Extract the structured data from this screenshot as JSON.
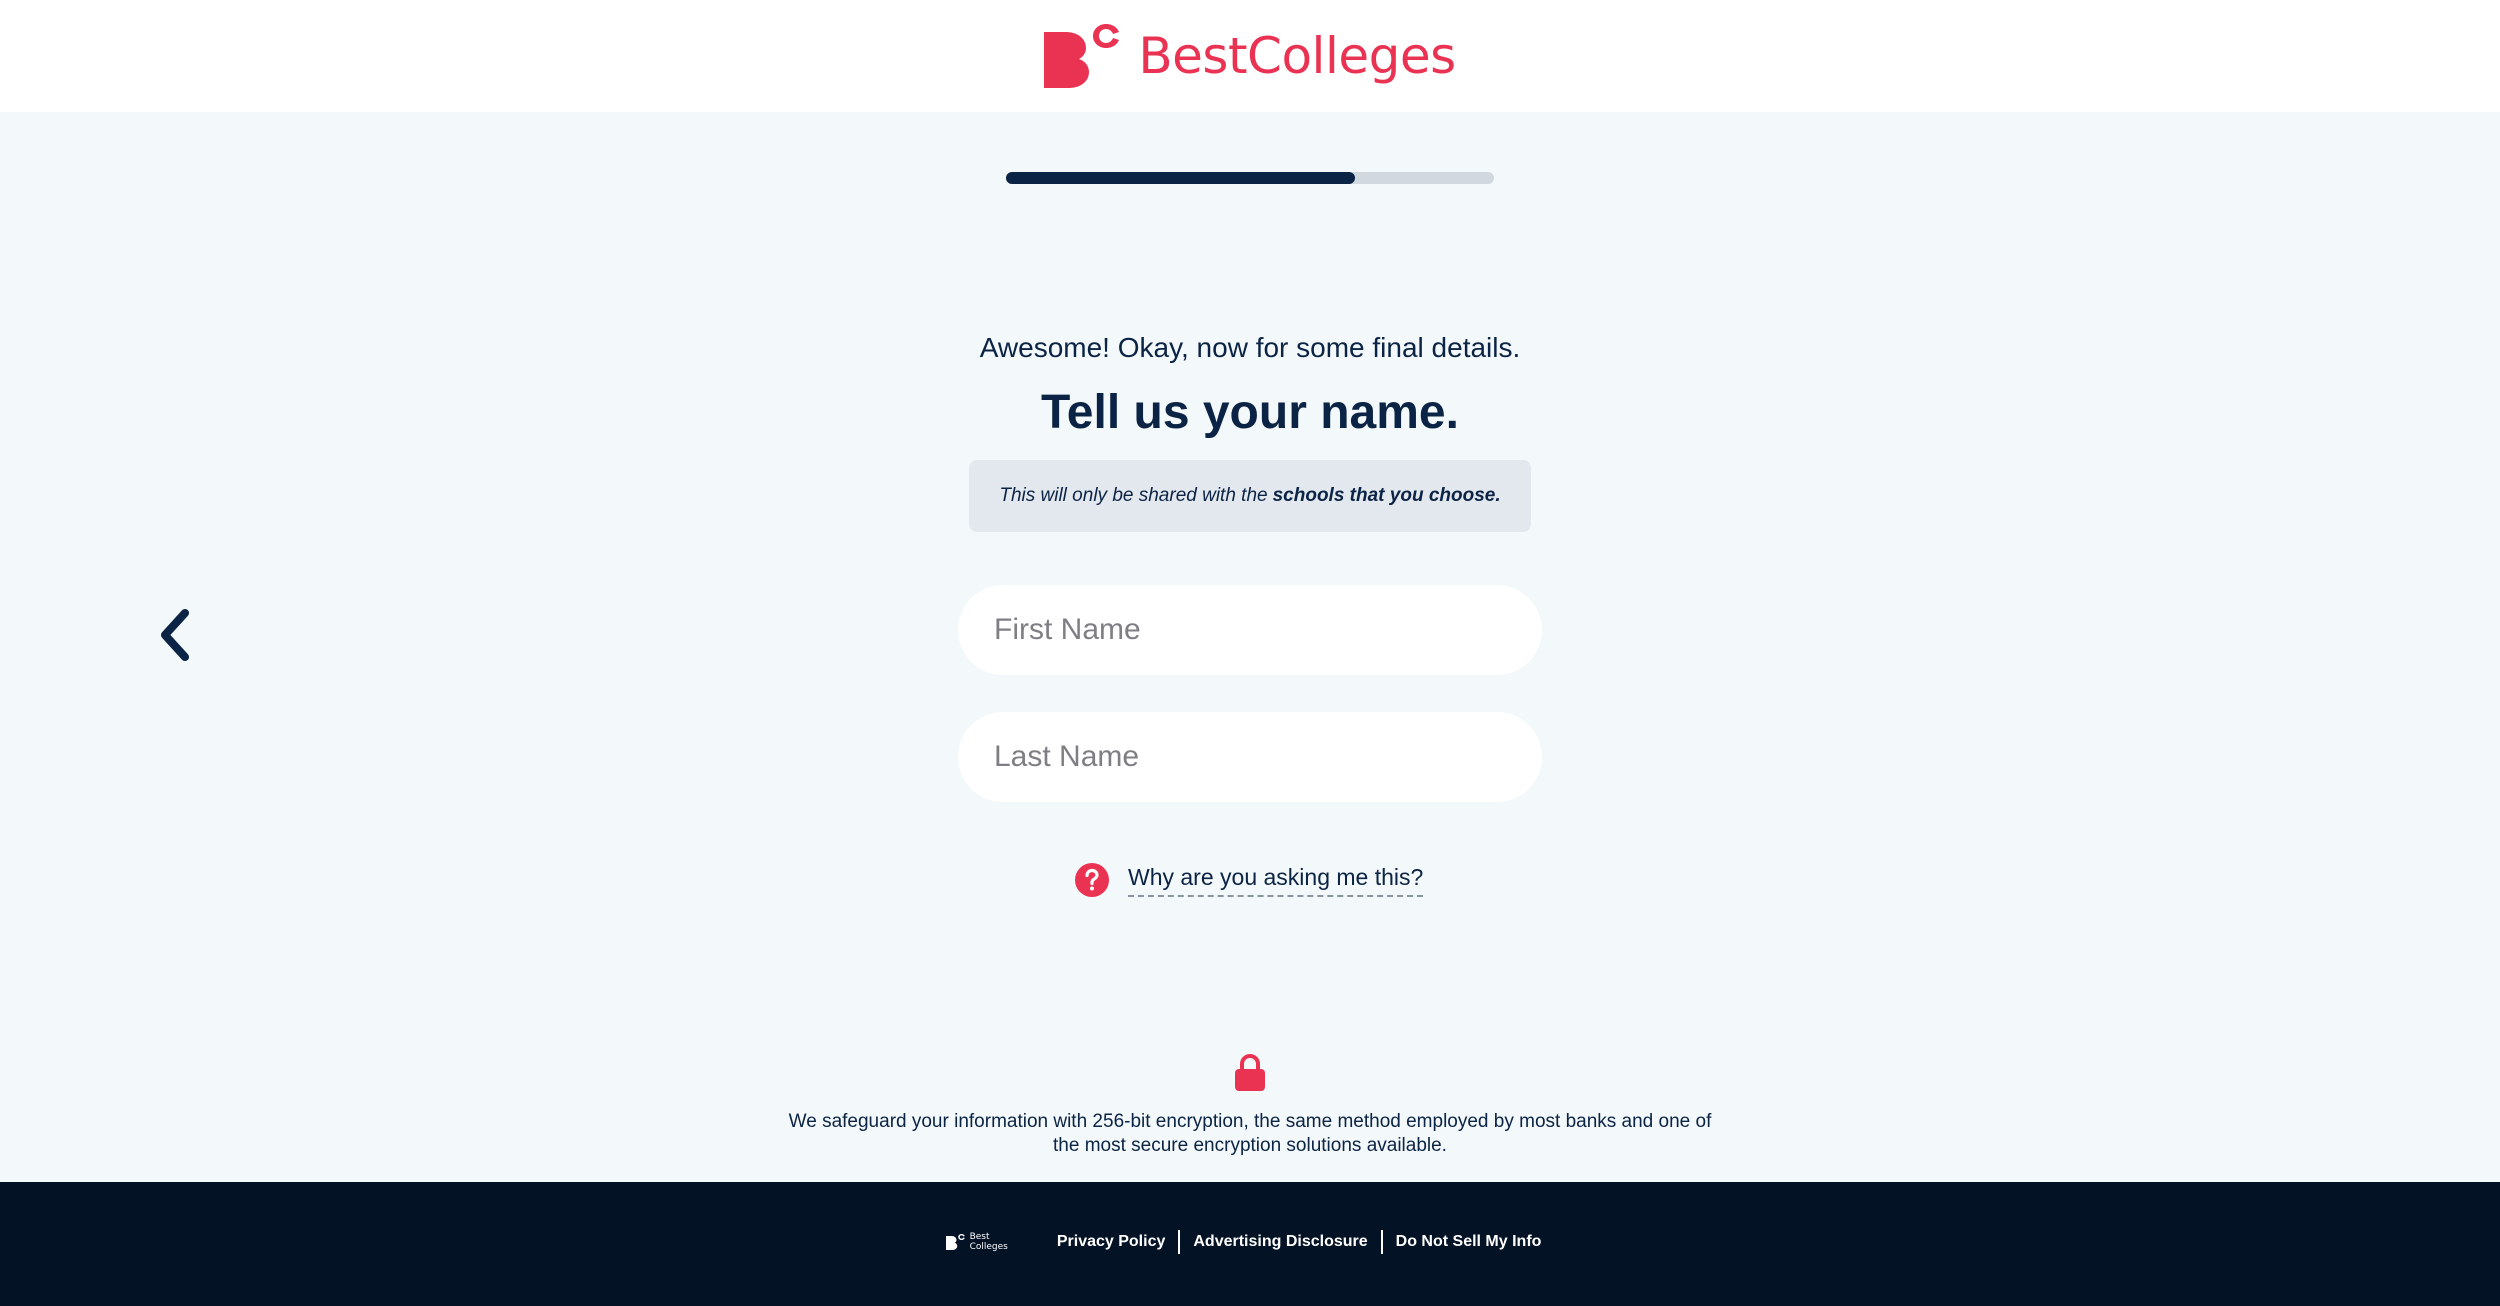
{
  "brand": {
    "name": "BestColleges",
    "logo_mark": "BC-logo-mark",
    "color": "#ea3352"
  },
  "progress": {
    "fraction": 0.715
  },
  "form": {
    "intro": "Awesome! Okay, now for some final details.",
    "heading": "Tell us your name.",
    "notice_prefix": "This will only be shared with the",
    "notice_bold": "schools that you choose.",
    "first_name_placeholder": "First Name",
    "first_name_value": "",
    "last_name_placeholder": "Last Name",
    "last_name_value": "",
    "why_link": "Why are you asking me this?",
    "why_icon": "question-circle-icon"
  },
  "nav": {
    "back_icon": "chevron-left-icon"
  },
  "security": {
    "icon": "lock-icon",
    "text": "We safeguard your information with 256-bit encryption, the same method employed by most banks and one of the most secure encryption solutions available."
  },
  "footer": {
    "logo_text_line1": "Best",
    "logo_text_line2": "Colleges",
    "links": [
      "Privacy Policy",
      "Advertising Disclosure",
      "Do Not Sell My Info"
    ]
  },
  "colors": {
    "navy": "#0b2344",
    "accent_red": "#ea3352",
    "page_bg": "#f3f8fa",
    "footer_bg": "#041226"
  }
}
